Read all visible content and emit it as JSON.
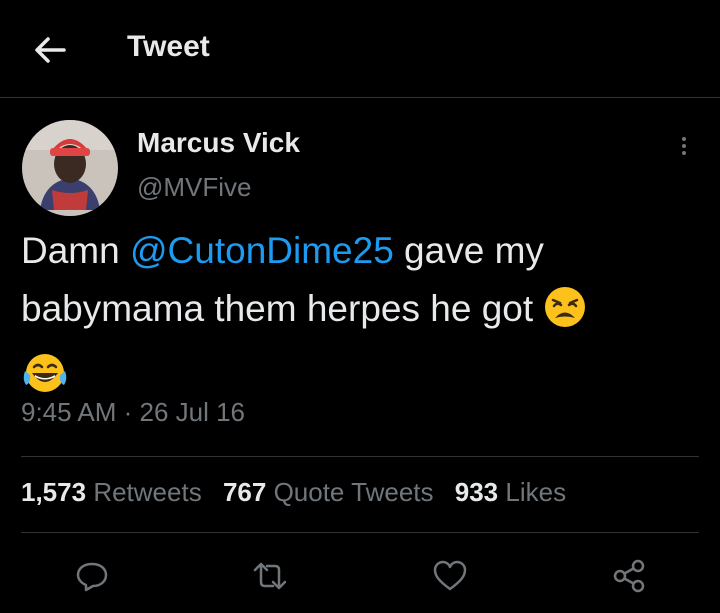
{
  "header": {
    "title": "Tweet",
    "back_icon": "arrow-left-icon"
  },
  "author": {
    "display_name": "Marcus Vick",
    "handle": "@MVFive",
    "avatar": "avatar-photo"
  },
  "tweet": {
    "text_part1": "Damn ",
    "mention": "@CutonDime25",
    "text_part2": " gave my babymama them herpes he got ",
    "emoji1": "weary-face-emoji",
    "emoji2": "tears-of-joy-emoji",
    "timestamp": "9:45 AM · 26 Jul 16"
  },
  "stats": {
    "retweets_count": "1,573",
    "retweets_label": "Retweets",
    "quotes_count": "767",
    "quotes_label": "Quote Tweets",
    "likes_count": "933",
    "likes_label": "Likes"
  },
  "actions": [
    "reply-icon",
    "retweet-icon",
    "like-icon",
    "share-icon"
  ],
  "colors": {
    "background": "#000000",
    "text": "#e7e9ea",
    "secondary": "#71767b",
    "accent": "#1d9bf0",
    "border": "#2f3336"
  }
}
